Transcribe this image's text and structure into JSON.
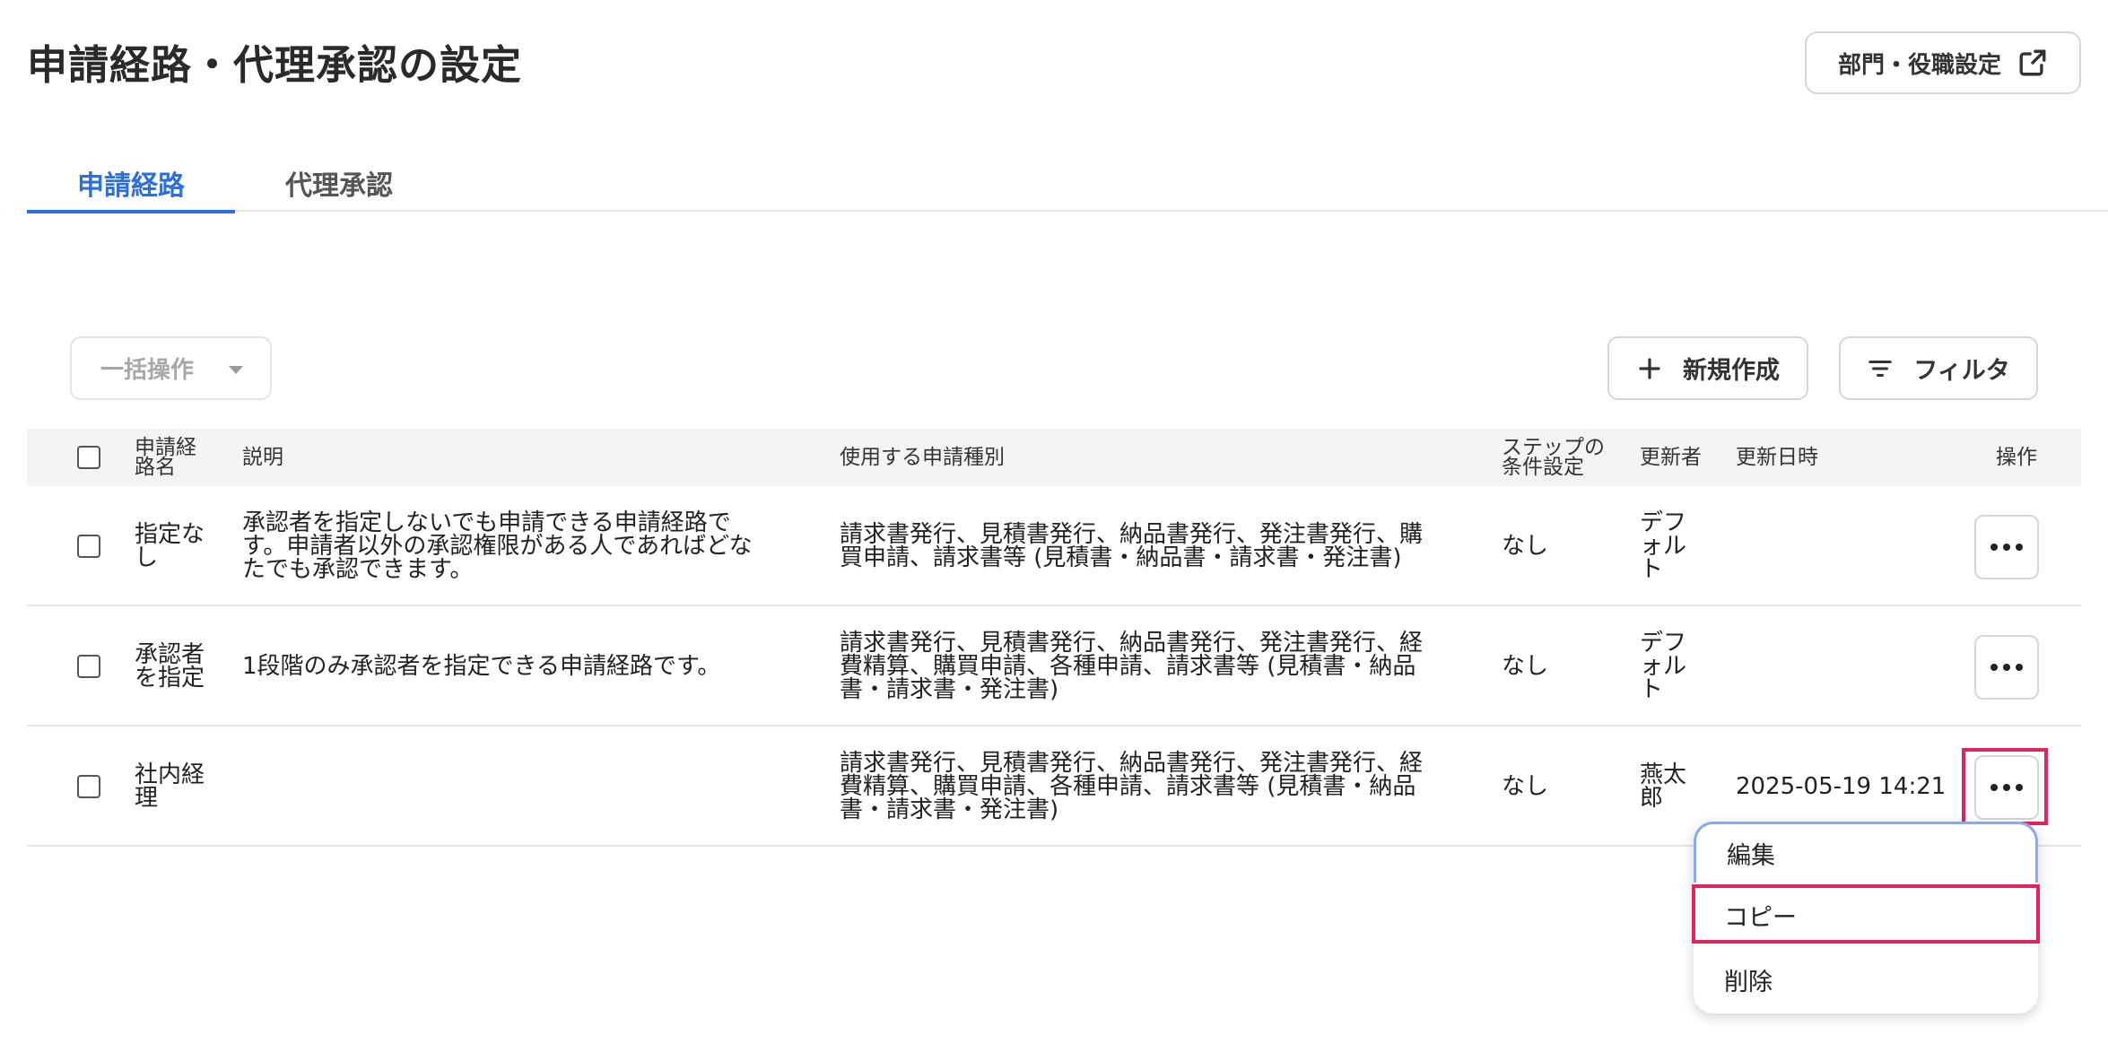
{
  "header": {
    "title": "申請経路・代理承認の設定",
    "dept_button_label": "部門・役職設定",
    "dept_button_icon": "external-link-icon"
  },
  "tabs": [
    {
      "label": "申請経路",
      "active": true
    },
    {
      "label": "代理承認",
      "active": false
    }
  ],
  "toolbar": {
    "bulk_label": "一括操作",
    "new_label": "新規作成",
    "filter_label": "フィルタ"
  },
  "table": {
    "headers": {
      "name_line1": "申請経",
      "name_line2": "路名",
      "description": "説明",
      "types": "使用する申請種別",
      "step_line1": "ステップの",
      "step_line2": "条件設定",
      "updater": "更新者",
      "updated_at": "更新日時",
      "actions": "操作"
    },
    "rows": [
      {
        "name_lines": [
          "指定な",
          "し"
        ],
        "description_lines": [
          "承認者を指定しないでも申請できる申請経路で",
          "す。申請者以外の承認権限がある人であればどな",
          "たでも承認できます。"
        ],
        "types_lines": [
          "請求書発行、見積書発行、納品書発行、発注書発行、購",
          "買申請、請求書等 (見積書・納品書・請求書・発注書)"
        ],
        "step_condition": "なし",
        "updater_lines": [
          "デフ",
          "ォル",
          "ト"
        ],
        "updated_at": ""
      },
      {
        "name_lines": [
          "承認者",
          "を指定"
        ],
        "description_lines": [
          "1段階のみ承認者を指定できる申請経路です。"
        ],
        "types_lines": [
          "請求書発行、見積書発行、納品書発行、発注書発行、経",
          "費精算、購買申請、各種申請、請求書等 (見積書・納品",
          "書・請求書・発注書)"
        ],
        "step_condition": "なし",
        "updater_lines": [
          "デフ",
          "ォル",
          "ト"
        ],
        "updated_at": ""
      },
      {
        "name_lines": [
          "社内経",
          "理"
        ],
        "description_lines": [],
        "types_lines": [
          "請求書発行、見積書発行、納品書発行、発注書発行、経",
          "費精算、購買申請、各種申請、請求書等 (見積書・納品",
          "書・請求書・発注書)"
        ],
        "step_condition": "なし",
        "updater_lines": [
          "燕太",
          "郎"
        ],
        "updated_at": "2025-05-19 14:21"
      }
    ]
  },
  "dropdown": {
    "items": [
      "編集",
      "コピー",
      "削除"
    ]
  },
  "colors": {
    "accent": "#2f6fd8",
    "highlight": "#e0245e",
    "focus_ring": "#8aa9ee"
  }
}
